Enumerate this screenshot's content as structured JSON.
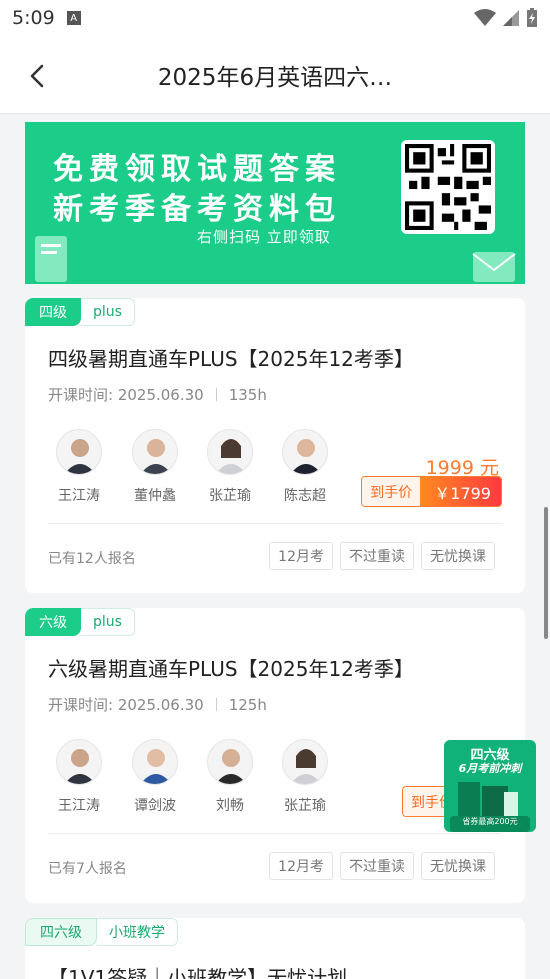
{
  "status_bar": {
    "time": "5:09",
    "sim_icon": "A"
  },
  "nav": {
    "title": "2025年6月英语四六…",
    "back_icon": "chevron-left-icon"
  },
  "banner": {
    "line1": "免费领取试题答案",
    "line2": "新考季备考资料包",
    "sub": "右侧扫码 立即领取"
  },
  "courses": [
    {
      "level": "四级",
      "plus": "plus",
      "title": "四级暑期直通车PLUS【2025年12考季】",
      "start_label": "开课时间: 2025.06.30",
      "hours": "135h",
      "teachers": [
        "王江涛",
        "董仲蠡",
        "张芷瑜",
        "陈志超"
      ],
      "original_price": "1999 元",
      "price_label": "到手价",
      "price": "￥1799",
      "enrolled": "已有12人报名",
      "features": [
        "12月考",
        "不过重读",
        "无忧换课"
      ]
    },
    {
      "level": "六级",
      "plus": "plus",
      "title": "六级暑期直通车PLUS【2025年12考季】",
      "start_label": "开课时间: 2025.06.30",
      "hours": "125h",
      "teachers": [
        "王江涛",
        "谭剑波",
        "刘畅",
        "张芷瑜"
      ],
      "original_price": "19",
      "price_label": "到手价",
      "price": "￥",
      "enrolled": "已有7人报名",
      "features": [
        "12月考",
        "不过重读",
        "无忧换课"
      ]
    },
    {
      "level": "四六级",
      "plus": "小班教学",
      "title": "【1V1答疑｜小班教学】无忧计划"
    }
  ],
  "promo": {
    "line1": "四六级",
    "line2": "6月考前冲刺",
    "badge": "省券最高200元"
  },
  "colors": {
    "accent": "#1ccd8a",
    "price": "#ff7b2e"
  }
}
